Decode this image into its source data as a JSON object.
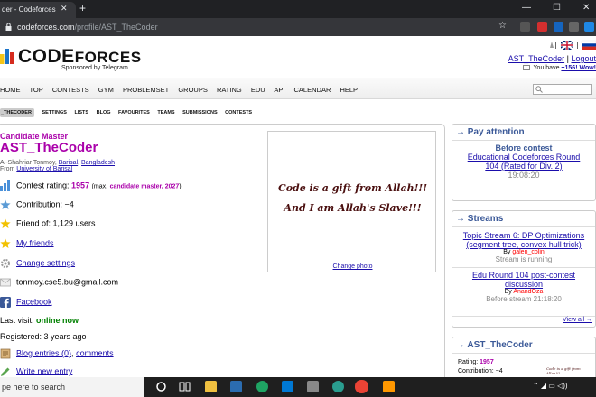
{
  "browser": {
    "tab_title": "der - Codeforces",
    "tab_close": "✕",
    "new_tab": "+",
    "win_min": "—",
    "win_max": "☐",
    "win_close": "✕",
    "url_host": "codeforces.com",
    "url_path": "/profile/AST_TheCoder",
    "star": "☆"
  },
  "header": {
    "logo_main": "CODE",
    "logo_rest": "FORCES",
    "sponsored": "Sponsored by Telegram",
    "user_link": "AST_TheCoder",
    "separator": "|",
    "logout": "Logout",
    "have_prefix": "You have",
    "have_count": "+156! Wow!"
  },
  "menu": {
    "items": [
      "HOME",
      "TOP",
      "CONTESTS",
      "GYM",
      "PROBLEMSET",
      "GROUPS",
      "RATING",
      "EDU",
      "API",
      "CALENDAR",
      "HELP"
    ]
  },
  "submenu": {
    "items": [
      "_THECODER",
      "SETTINGS",
      "LISTS",
      "BLOG",
      "FAVOURITES",
      "TEAMS",
      "SUBMISSIONS",
      "CONTESTS"
    ]
  },
  "profile": {
    "rank": "Candidate Master",
    "handle": "AST_TheCoder",
    "name_prefix": "Al-Shahriar Tonmoy,",
    "city": "Barisal",
    "country": "Bangladesh",
    "from_label": "From",
    "organization": "University of Barisal",
    "rating_label": "Contest rating:",
    "rating_value": "1957",
    "rating_max_open": "(max.",
    "rating_max_rank": "candidate master, 2027",
    "rating_max_close": ")",
    "contribution": "Contribution: −4",
    "friend_of": "Friend of: 1,129 users",
    "my_friends": "My friends",
    "change_settings": "Change settings",
    "email": "tonmoy.cse5.bu@gmail.com",
    "facebook": "Facebook",
    "last_visit_label": "Last visit:",
    "last_visit_value": "online now",
    "registered": "Registered: 3 years ago",
    "blog_entries": "Blog entries (0)",
    "blog_sep": ",",
    "comments": "comments",
    "write_entry": "Write new entry",
    "quote_line1": "Code is a gift from Allah!!!",
    "quote_line2": "And I am Allah's Slave!!!",
    "change_photo": "Change photo"
  },
  "sidebar": {
    "arrow": "→",
    "pay_attention": {
      "title": "Pay attention",
      "before": "Before contest",
      "contest": "Educational Codeforces Round 104 (Rated for Div. 2)",
      "time": "19:08:20"
    },
    "streams": {
      "title": "Streams",
      "s1_title": "Topic Stream 6: DP Optimizations (segment tree, convex hull trick)",
      "s1_by": "By",
      "s1_author": "galen_colin",
      "s1_status": "Stream is running",
      "s2_title": "Edu Round 104 post-contest discussion",
      "s2_by": "By",
      "s2_author": "AnandOza",
      "s2_status": "Before stream 21:18:20",
      "view_all": "View all →"
    },
    "user_box": {
      "title": "AST_TheCoder",
      "rating_label": "Rating:",
      "rating_value": "1957",
      "contribution": "Contribution: −4",
      "mini_quote": "Code is a gift from Allah!!!"
    }
  },
  "taskbar": {
    "search_placeholder": "pe here to search"
  },
  "colors": {
    "candidate_master": "#aa00aa",
    "online": "#008000",
    "link": "#1a0dab",
    "sidebar_head": "#3b5998",
    "browser_dark": "#202124"
  }
}
